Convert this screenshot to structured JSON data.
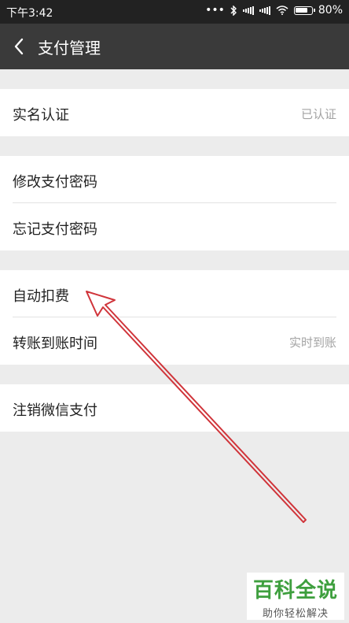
{
  "status_bar": {
    "time": "下午3:42",
    "icons": [
      "dots-icon",
      "bluetooth-icon",
      "signal-icon",
      "signal-icon",
      "wifi-icon",
      "battery-icon"
    ],
    "battery": "80%"
  },
  "nav": {
    "title": "支付管理",
    "back_icon": "chevron-left-icon"
  },
  "groups": [
    {
      "rows": [
        {
          "label": "实名认证",
          "value": "已认证"
        }
      ]
    },
    {
      "rows": [
        {
          "label": "修改支付密码"
        },
        {
          "label": "忘记支付密码"
        }
      ]
    },
    {
      "rows": [
        {
          "label": "自动扣费"
        },
        {
          "label": "转账到账时间",
          "value": "实时到账"
        }
      ]
    },
    {
      "rows": [
        {
          "label": "注销微信支付"
        }
      ]
    }
  ],
  "watermark": {
    "main": "百科全说",
    "sub": "助你轻松解决"
  },
  "colors": {
    "status_bar": "#222222",
    "nav_bar": "#3a3a3a",
    "background": "#ececec",
    "annotation_arrow": "#d0343a",
    "watermark_green": "#3e9f3e"
  }
}
